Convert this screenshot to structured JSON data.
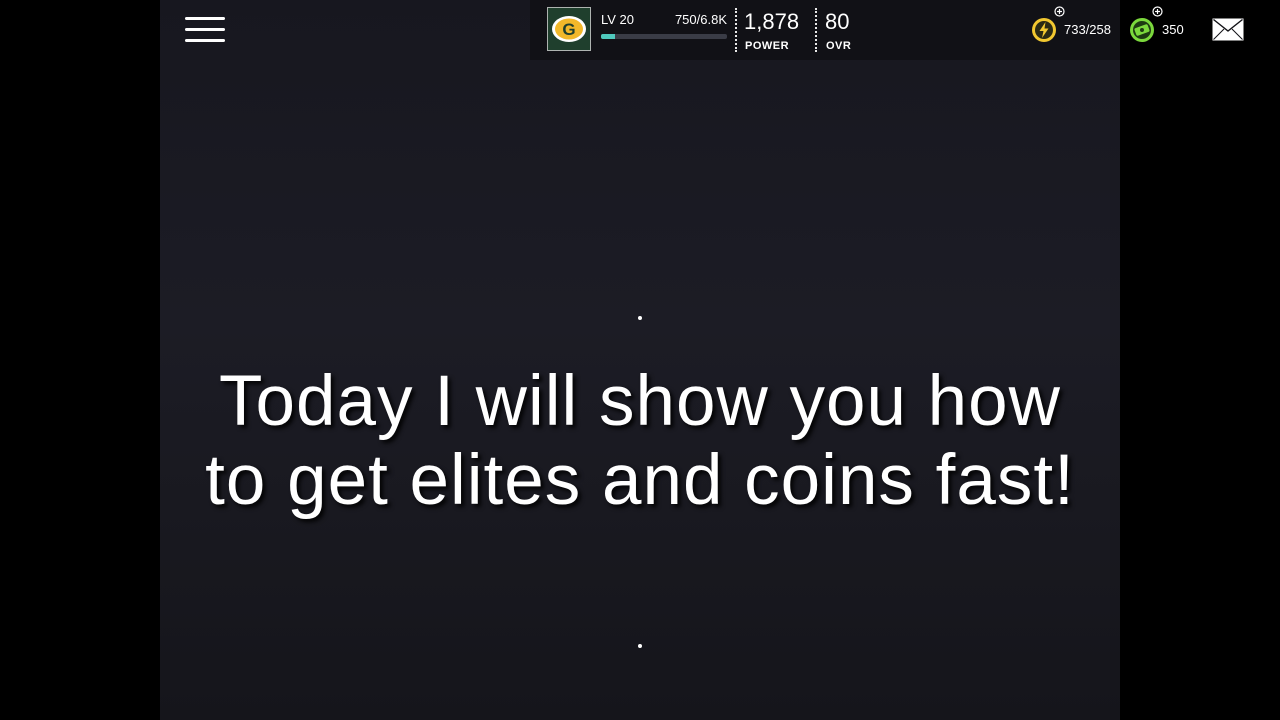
{
  "hud": {
    "level_label": "LV 20",
    "xp_text": "750/6.8K",
    "xp_progress": 0.11,
    "power_value": "1,878",
    "power_label": "POWER",
    "ovr_value": "80",
    "ovr_label": "OVR",
    "stamina_value": "733/258",
    "cash_value": "350",
    "team_logo_letter": "G"
  },
  "caption": {
    "line1": "Today I will show you how",
    "line2": "to get elites and coins fast!"
  },
  "colors": {
    "team_green": "#1f3f2d",
    "team_gold": "#f2b82a",
    "xp_bar": "#4fc9bd",
    "stamina_yellow": "#f2c830",
    "cash_green": "#7bd83c"
  },
  "icons": {
    "menu": "menu-icon",
    "stamina": "lightning-icon",
    "cash": "cash-icon",
    "mail": "mail-icon"
  }
}
